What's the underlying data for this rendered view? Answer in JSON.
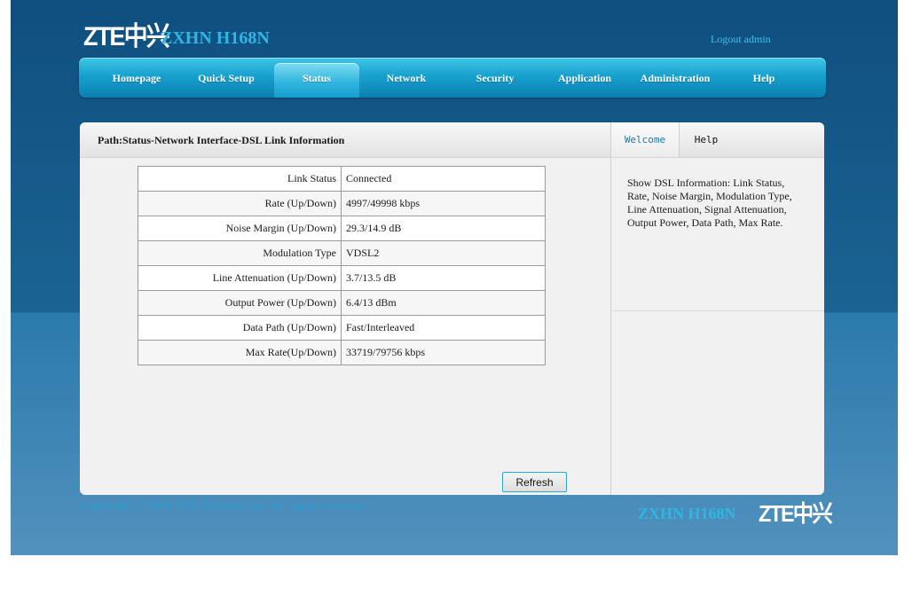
{
  "header": {
    "logo": "ZTE中兴",
    "model": "ZXHN H168N",
    "logout_label": "Logout admin"
  },
  "nav": {
    "items": [
      {
        "label": "Homepage"
      },
      {
        "label": "Quick Setup"
      },
      {
        "label": "Status"
      },
      {
        "label": "Network"
      },
      {
        "label": "Security"
      },
      {
        "label": "Application"
      },
      {
        "label": "Administration"
      },
      {
        "label": "Help"
      }
    ],
    "active": "Status"
  },
  "main": {
    "path": "Path:Status-Network Interface-DSL Link Information",
    "rows": [
      {
        "label": "Link Status",
        "value": "Connected"
      },
      {
        "label": "Rate (Up/Down)",
        "value": "4997/49998 kbps"
      },
      {
        "label": "Noise Margin (Up/Down)",
        "value": "29.3/14.9 dB"
      },
      {
        "label": "Modulation Type",
        "value": "VDSL2"
      },
      {
        "label": "Line Attenuation (Up/Down)",
        "value": "3.7/13.5 dB"
      },
      {
        "label": "Output Power (Up/Down)",
        "value": "6.4/13 dBm"
      },
      {
        "label": "Data Path (Up/Down)",
        "value": "Fast/Interleaved"
      },
      {
        "label": "Max Rate(Up/Down)",
        "value": "33719/79756 kbps"
      }
    ],
    "refresh_label": "Refresh"
  },
  "sidebar": {
    "tabs": [
      {
        "label": "Welcome"
      },
      {
        "label": "Help"
      }
    ],
    "help_text": "Show DSL Information: Link Status, Rate, Noise Margin, Modulation Type, Line Attenuation, Signal Attenuation, Output Power, Data Path, Max Rate."
  },
  "footer": {
    "copyright": "Copyright © 2011 ZTE Corporation. All rights reserved.",
    "model": "ZXHN H168N",
    "logo": "ZTE中兴"
  },
  "colors": {
    "accent": "#2fb6e6",
    "nav_bg": "#17a1cd",
    "frame_bg": "#0f4f7f"
  }
}
